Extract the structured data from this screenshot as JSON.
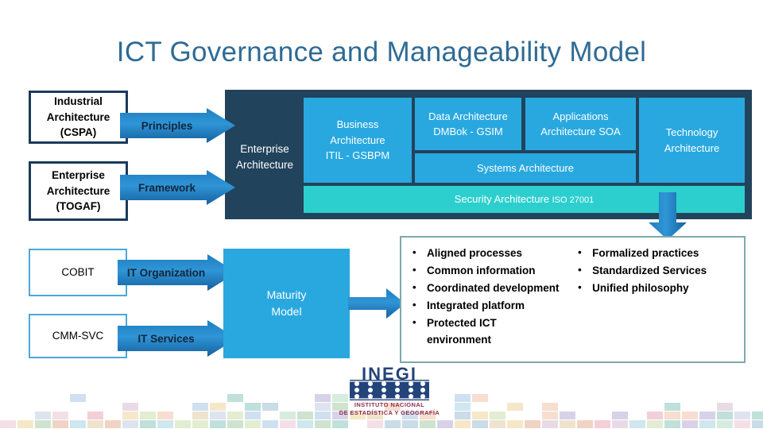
{
  "slide": {
    "title": "ICT Governance and Manageability Model",
    "title_color": "#2f6b95",
    "background": "#ffffff"
  },
  "palette": {
    "navy_panel": "#22435c",
    "cyan_tile": "#29a8e0",
    "teal_tile": "#2ccfce",
    "arrow_blue": "#2f95d6",
    "box_border_navy": "#1b3a5c",
    "box_border_lightblue": "#4aa9d8",
    "bullet_panel_border": "#7ea8ac"
  },
  "inputs": {
    "industrial_architecture": "Industrial\nArchitecture\n(CSPA)",
    "industrial_architecture_lines": [
      "Industrial",
      "Architecture",
      "(CSPA)"
    ],
    "enterprise_architecture_togaf_lines": [
      "Enterprise",
      "Architecture",
      "(TOGAF)"
    ],
    "cobit": "COBIT",
    "cmm_svc": "CMM-SVC"
  },
  "arrows": {
    "principles": "Principles",
    "framework": "Framework",
    "it_organization": "IT Organization",
    "it_services": "IT Services"
  },
  "enterprise_panel": {
    "label_lines": [
      "Enterprise",
      "Architecture"
    ],
    "tiles": [
      {
        "id": "business-architecture",
        "lines": [
          "Business",
          "Architecture",
          "ITIL - GSBPM"
        ]
      },
      {
        "id": "data-architecture",
        "lines": [
          "Data Architecture",
          "DMBok - GSIM"
        ]
      },
      {
        "id": "applications-architecture",
        "lines": [
          "Applications",
          "Architecture SOA"
        ]
      },
      {
        "id": "technology-architecture",
        "lines": [
          "Technology",
          "Architecture"
        ]
      },
      {
        "id": "systems-architecture",
        "lines": [
          "Systems Architecture"
        ]
      },
      {
        "id": "security-architecture",
        "main": "Security Architecture",
        "suffix": "ISO 27001"
      }
    ]
  },
  "maturity_model": {
    "lines": [
      "Maturity",
      "Model"
    ]
  },
  "outcomes": {
    "left_column": [
      "Aligned processes",
      "Common information",
      "Coordinated development",
      "Integrated platform",
      "Protected ICT environment"
    ],
    "right_column": [
      "Formalized practices",
      "Standardized Services",
      "Unified philosophy"
    ]
  },
  "footer": {
    "logo_word": "INEGI",
    "logo_sub_line1": "INSTITUTO NACIONAL",
    "logo_sub_line2": "DE ESTADÍSTICA Y GEOGRAFÍA"
  }
}
